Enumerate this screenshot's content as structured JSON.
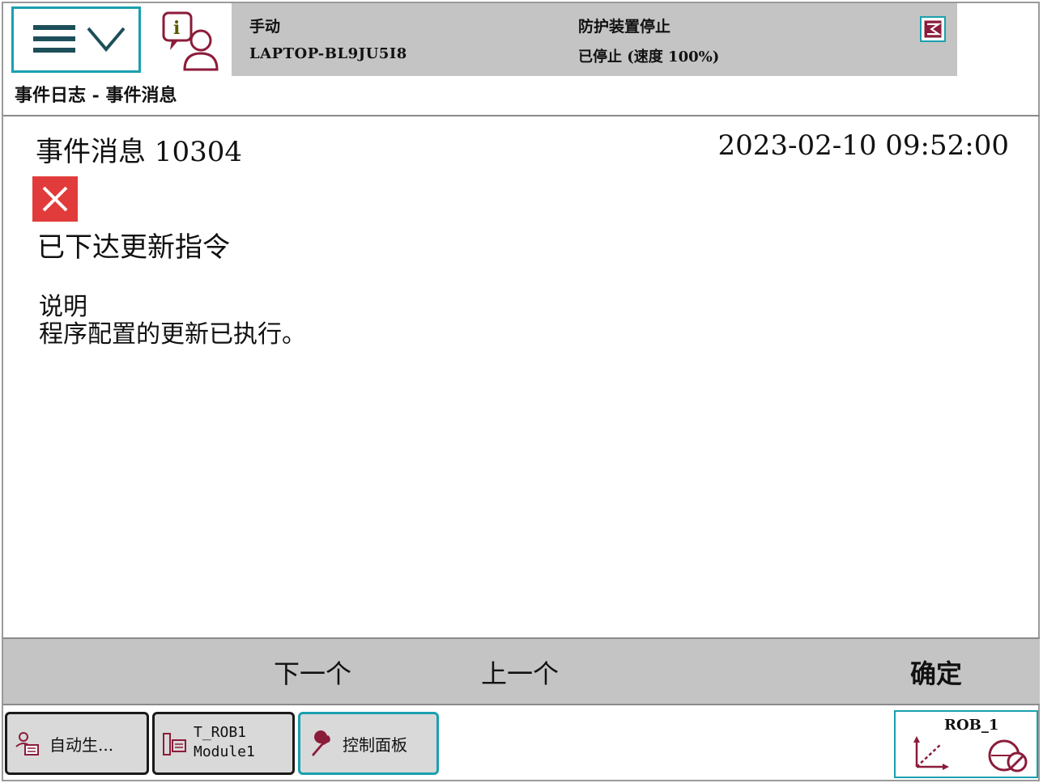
{
  "header": {
    "mode": "手动",
    "hostname": "LAPTOP-BL9JU5I8",
    "guard_status": "防护装置停止",
    "run_status": "已停止 (速度 100%)"
  },
  "page_title": "事件日志 - 事件消息",
  "event": {
    "title": "事件消息 10304",
    "timestamp": "2023-02-10 09:52:00",
    "severity_icon": "error-x-icon",
    "message": "已下达更新指令",
    "description_label": "说明",
    "description_text": "程序配置的更新已执行。"
  },
  "command_bar": {
    "next_label": "下一个",
    "prev_label": "上一个",
    "ok_label": "确定"
  },
  "taskbar": {
    "items": [
      {
        "label": "自动生...",
        "icon": "auto-production-icon"
      },
      {
        "line1": "T_ROB1",
        "line2": "Module1",
        "icon": "program-editor-icon"
      },
      {
        "label": "控制面板",
        "icon": "wrench-icon"
      }
    ],
    "robot_label": "ROB_1"
  },
  "colors": {
    "accent": "#1aa0b0",
    "error": "#e23b3b",
    "bar_gray": "#c4c4c4"
  }
}
